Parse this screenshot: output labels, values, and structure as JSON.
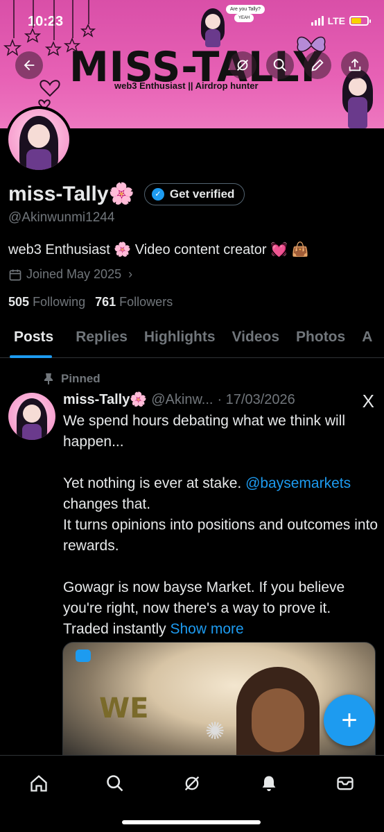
{
  "status_bar": {
    "time": "10:23",
    "network": "LTE",
    "battery_color": "#f6d300"
  },
  "banner": {
    "title": "MISS-TALLY",
    "subtitle": "web3 Enthusiast || Airdrop hunter",
    "bubble_1": "Are you Tally?",
    "bubble_2": "YEAH",
    "background_color": "#e761b5"
  },
  "header_actions": {
    "back_icon": "arrow-left-icon",
    "grok_icon": "grok-icon",
    "search_icon": "search-icon",
    "edit_icon": "pencil-icon",
    "share_icon": "share-icon"
  },
  "profile": {
    "name": "miss-Tally🌸",
    "verify_label": "Get verified",
    "handle": "@Akinwunmi1244",
    "bio": "web3 Enthusiast 🌸 Video content creator 💓 👜",
    "joined": "Joined May 2025",
    "following_count": "505",
    "following_label": "Following",
    "followers_count": "761",
    "followers_label": "Followers"
  },
  "tabs": [
    {
      "label": "Posts"
    },
    {
      "label": "Replies"
    },
    {
      "label": "Highlights"
    },
    {
      "label": "Videos"
    },
    {
      "label": "Photos"
    },
    {
      "label": "A"
    }
  ],
  "pinned_post": {
    "pinned_label": "Pinned",
    "author_name": "miss-Tally🌸",
    "author_handle": "@Akinw...",
    "date": "· 17/03/2026",
    "platform": "X",
    "para1": "We spend hours debating what we think will happen...",
    "para2_before": "Yet nothing is ever at stake. ",
    "para2_link": "@baysemarkets",
    "para2_after": " changes that.",
    "para2_line2": "It turns opinions into positions and outcomes into rewards.",
    "para3": "Gowagr is now bayse Market. If you believe you're right, now there's a way to prove it. Traded instantly ",
    "show_more": "Show more",
    "media_text": "WE"
  },
  "fab": {
    "label": "+"
  },
  "bottom_nav": [
    {
      "name": "home-icon"
    },
    {
      "name": "search-icon"
    },
    {
      "name": "grok-icon"
    },
    {
      "name": "bell-icon"
    },
    {
      "name": "mail-icon"
    }
  ],
  "colors": {
    "accent": "#1d9bf0",
    "muted": "#71767b",
    "text": "#e7e9ea",
    "divider": "#2f3336"
  }
}
